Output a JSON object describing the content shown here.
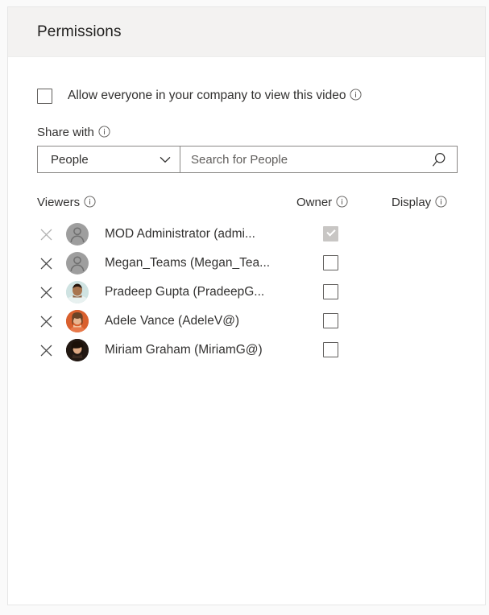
{
  "card": {
    "title": "Permissions"
  },
  "allow_everyone": {
    "label": "Allow everyone in your company to view this video",
    "checked": false,
    "info_icon": "info-icon"
  },
  "share_with": {
    "label": "Share with",
    "info_icon": "info-icon",
    "dropdown": {
      "selected": "People",
      "options": [
        "People"
      ],
      "chevron_icon": "chevron-down-icon"
    },
    "search": {
      "value": "",
      "placeholder": "Search for People",
      "icon": "search-icon"
    }
  },
  "table": {
    "headers": {
      "viewers": "Viewers",
      "owner": "Owner",
      "display": "Display"
    },
    "header_info_icon": "info-icon",
    "remove_icon": "close-icon",
    "rows": [
      {
        "name": "MOD Administrator (admi...",
        "avatar_type": "placeholder",
        "avatar_bg": "#9e9e9e",
        "owner_checked": true,
        "owner_disabled": true,
        "remove_disabled": true
      },
      {
        "name": "Megan_Teams (Megan_Tea...",
        "avatar_type": "placeholder",
        "avatar_bg": "#9e9e9e",
        "owner_checked": false,
        "owner_disabled": false,
        "remove_disabled": false
      },
      {
        "name": "Pradeep Gupta (PradeepG...",
        "avatar_type": "photo",
        "avatar_bg": "#cfe3e2",
        "owner_checked": false,
        "owner_disabled": false,
        "remove_disabled": false
      },
      {
        "name": "Adele Vance (AdeleV@)",
        "avatar_type": "photo",
        "avatar_bg": "#d9602e",
        "owner_checked": false,
        "owner_disabled": false,
        "remove_disabled": false
      },
      {
        "name": "Miriam Graham (MiriamG@)",
        "avatar_type": "photo",
        "avatar_bg": "#221812",
        "owner_checked": false,
        "owner_disabled": false,
        "remove_disabled": false
      }
    ]
  },
  "colors": {
    "header_bg": "#f3f2f1",
    "card_bg": "#ffffff",
    "page_bg": "#fafafa",
    "text": "#323130",
    "border": "#8a8886",
    "disabled_fill": "#c8c6c4"
  }
}
